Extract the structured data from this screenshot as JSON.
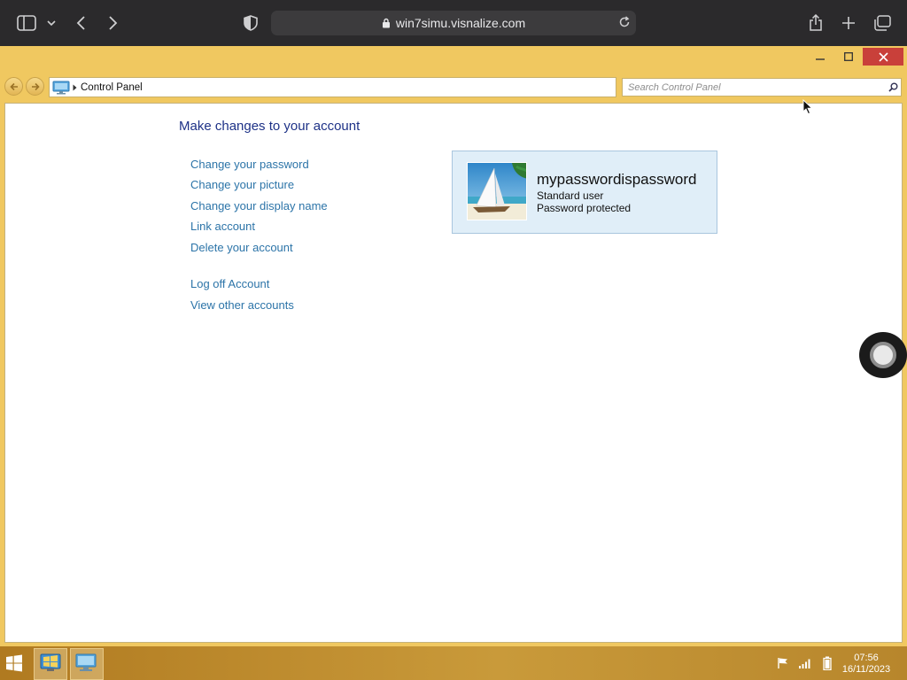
{
  "browser": {
    "url": "win7simu.visnalize.com"
  },
  "address_bar": {
    "breadcrumb": "Control Panel"
  },
  "search": {
    "placeholder": "Search Control Panel"
  },
  "page": {
    "title": "Make changes to your account",
    "links": [
      "Change your password",
      "Change your picture",
      "Change your display name",
      "Link account",
      "Delete your account"
    ],
    "links_secondary": [
      "Log off Account",
      "View other accounts"
    ]
  },
  "account": {
    "name": "mypasswordispassword",
    "type": "Standard user",
    "status": "Password protected"
  },
  "taskbar": {
    "time": "07:56",
    "date": "16/11/2023"
  },
  "colors": {
    "window_frame": "#f0c860",
    "link": "#2c74a8",
    "title": "#1e3287",
    "close_button": "#c9403a"
  }
}
